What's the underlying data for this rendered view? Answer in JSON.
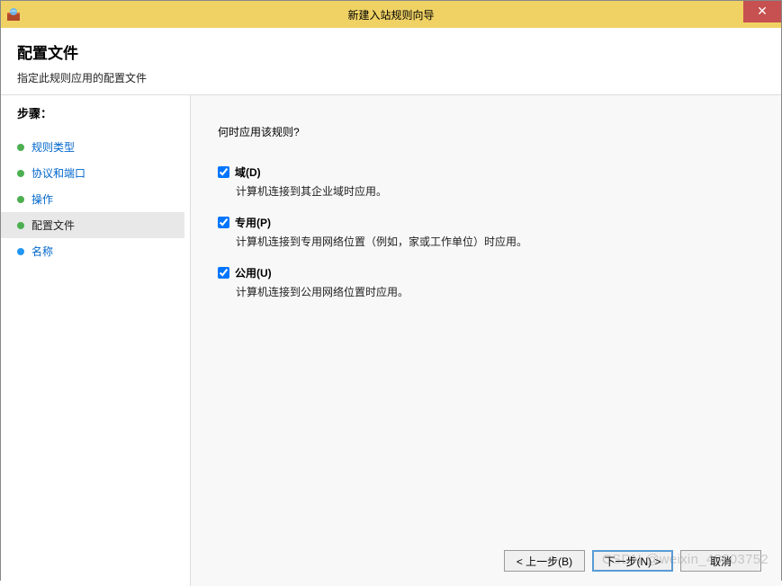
{
  "window": {
    "title": "新建入站规则向导"
  },
  "header": {
    "title": "配置文件",
    "subtitle": "指定此规则应用的配置文件"
  },
  "sidebar": {
    "steps_label": "步骤：",
    "items": [
      {
        "label": "规则类型"
      },
      {
        "label": "协议和端口"
      },
      {
        "label": "操作"
      },
      {
        "label": "配置文件"
      },
      {
        "label": "名称"
      }
    ]
  },
  "main": {
    "question": "何时应用该规则?",
    "options": [
      {
        "label": "域(D)",
        "desc": "计算机连接到其企业域时应用。",
        "checked": true
      },
      {
        "label": "专用(P)",
        "desc": "计算机连接到专用网络位置（例如，家或工作单位）时应用。",
        "checked": true
      },
      {
        "label": "公用(U)",
        "desc": "计算机连接到公用网络位置时应用。",
        "checked": true
      }
    ]
  },
  "buttons": {
    "back": "< 上一步(B)",
    "next": "下一步(N) >",
    "cancel": "取消"
  },
  "watermark": "CSDN @weixin_48803752"
}
